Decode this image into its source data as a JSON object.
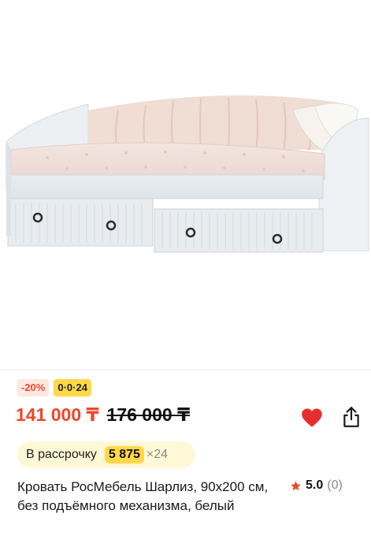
{
  "product": {
    "image_alt": "",
    "badges": {
      "discount": "-20%",
      "installment": "0·0·24"
    },
    "price": {
      "current": "141 000 ₸",
      "old": "176 000 ₸"
    },
    "installment": {
      "label": "В рассрочку",
      "amount": "5 875",
      "multiplier": "×24"
    },
    "title": "Кровать РосМебель Шарлиз, 90х200 см, без подъёмного механизма, белый",
    "rating": {
      "value": "5.0",
      "count": "(0)"
    }
  },
  "colors": {
    "accent_red": "#f0462a",
    "yellow": "#ffd84a",
    "pill_bg": "#fff8d6",
    "heart": "#e52e2e"
  },
  "icons": {
    "favorite": "heart-icon",
    "share": "share-icon",
    "rating": "star-icon"
  }
}
